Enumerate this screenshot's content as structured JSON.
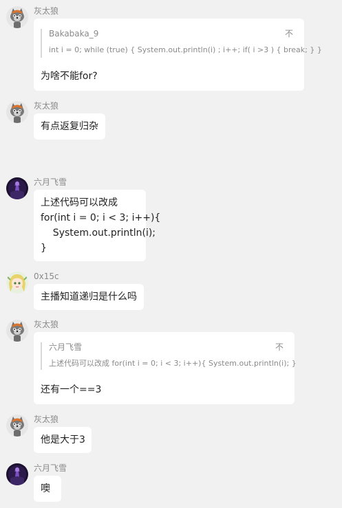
{
  "messages": [
    {
      "sender": "灰太狼",
      "avatar": "wolf-avatar",
      "quote": {
        "sender": "Bakabaka_9",
        "text": "int i = 0; while (true) { System.out.println(i) ; i++; if( i >3 ) { break; } }",
        "close": "不"
      },
      "text": "为啥不能for?"
    },
    {
      "sender": "灰太狼",
      "avatar": "wolf-avatar",
      "text": "有点返复归杂"
    },
    {
      "sender": "六月飞雪",
      "avatar": "dark-figure-avatar",
      "lines": [
        "上述代码可以改成",
        "for(int i = 0; i < 3; i++){",
        "    System.out.println(i);",
        "}"
      ]
    },
    {
      "sender": "0x15c",
      "avatar": "anime-girl-avatar",
      "text": "主播知道递归是什么吗"
    },
    {
      "sender": "灰太狼",
      "avatar": "wolf-avatar",
      "quote": {
        "sender": "六月飞雪",
        "text": "上述代码可以改成 for(int i = 0; i < 3; i++){ System.out.println(i); }",
        "close": "不"
      },
      "text": "还有一个==3"
    },
    {
      "sender": "灰太狼",
      "avatar": "wolf-avatar",
      "text": "他是大于3"
    },
    {
      "sender": "六月飞雪",
      "avatar": "dark-figure-avatar",
      "text": "噢"
    }
  ]
}
